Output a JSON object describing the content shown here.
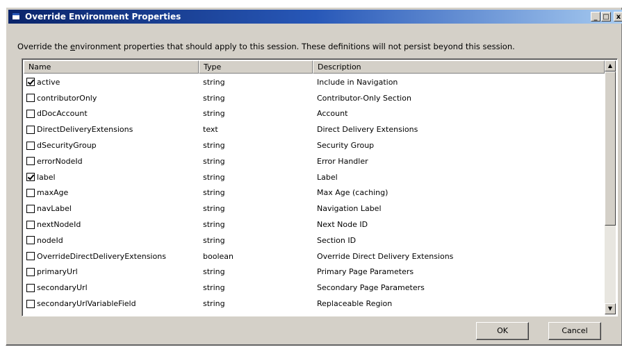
{
  "window": {
    "title": "Override Environment Properties",
    "controls": {
      "minimize": "_",
      "maximize": "□",
      "close": "x"
    }
  },
  "instruction": {
    "before": "Override the ",
    "accel": "e",
    "after": "nvironment properties that should apply to this session.  These definitions will not persist beyond this session."
  },
  "table": {
    "headers": {
      "name": "Name",
      "type": "Type",
      "description": "Description"
    },
    "rows": [
      {
        "checked": true,
        "name": "active",
        "type": "string",
        "description": "Include in Navigation"
      },
      {
        "checked": false,
        "name": "contributorOnly",
        "type": "string",
        "description": "Contributor-Only Section"
      },
      {
        "checked": false,
        "name": "dDocAccount",
        "type": "string",
        "description": "Account"
      },
      {
        "checked": false,
        "name": "DirectDeliveryExtensions",
        "type": "text",
        "description": "Direct Delivery Extensions"
      },
      {
        "checked": false,
        "name": "dSecurityGroup",
        "type": "string",
        "description": "Security Group"
      },
      {
        "checked": false,
        "name": "errorNodeId",
        "type": "string",
        "description": "Error Handler"
      },
      {
        "checked": true,
        "name": "label",
        "type": "string",
        "description": "Label"
      },
      {
        "checked": false,
        "name": "maxAge",
        "type": "string",
        "description": "Max Age (caching)"
      },
      {
        "checked": false,
        "name": "navLabel",
        "type": "string",
        "description": "Navigation Label"
      },
      {
        "checked": false,
        "name": "nextNodeId",
        "type": "string",
        "description": "Next Node ID"
      },
      {
        "checked": false,
        "name": "nodeId",
        "type": "string",
        "description": "Section ID"
      },
      {
        "checked": false,
        "name": "OverrideDirectDeliveryExtensions",
        "type": "boolean",
        "description": "Override Direct Delivery Extensions"
      },
      {
        "checked": false,
        "name": "primaryUrl",
        "type": "string",
        "description": "Primary Page Parameters"
      },
      {
        "checked": false,
        "name": "secondaryUrl",
        "type": "string",
        "description": "Secondary Page Parameters"
      },
      {
        "checked": false,
        "name": "secondaryUrlVariableField",
        "type": "string",
        "description": "Replaceable Region"
      }
    ]
  },
  "buttons": {
    "ok": "OK",
    "cancel": "Cancel"
  }
}
